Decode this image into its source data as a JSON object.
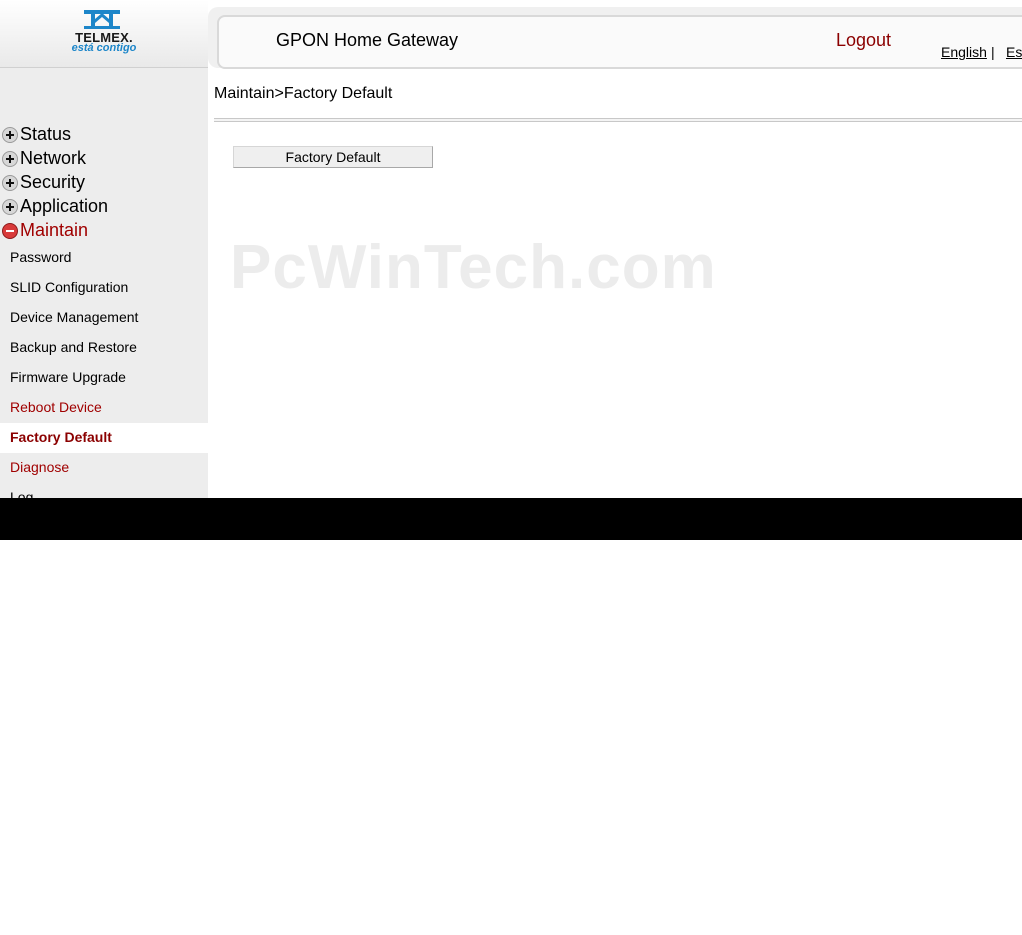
{
  "logo": {
    "brand": "TELMEX.",
    "tagline": "está contigo",
    "icon": "telmex-logo-icon",
    "accent_color": "#1d86c9"
  },
  "header": {
    "title": "GPON Home Gateway",
    "logout_label": "Logout",
    "logout_color": "#8b0000",
    "lang_english": "English",
    "lang_separator": "|",
    "lang_spanish": "Es"
  },
  "sidebar": {
    "menus": [
      {
        "label": "Status",
        "icon": "plus-icon",
        "expanded": false
      },
      {
        "label": "Network",
        "icon": "plus-icon",
        "expanded": false
      },
      {
        "label": "Security",
        "icon": "plus-icon",
        "expanded": false
      },
      {
        "label": "Application",
        "icon": "plus-icon",
        "expanded": false
      },
      {
        "label": "Maintain",
        "icon": "minus-icon",
        "expanded": true
      }
    ],
    "submenu": [
      {
        "label": "Password"
      },
      {
        "label": "SLID Configuration"
      },
      {
        "label": "Device Management"
      },
      {
        "label": "Backup and Restore"
      },
      {
        "label": "Firmware Upgrade"
      },
      {
        "label": "Reboot Device"
      },
      {
        "label": "Factory Default",
        "selected": true
      },
      {
        "label": "Diagnose"
      },
      {
        "label": "Log"
      }
    ]
  },
  "main": {
    "breadcrumb": "Maintain>Factory Default",
    "factory_button_label": "Factory Default"
  },
  "watermark": "PcWinTech.com"
}
